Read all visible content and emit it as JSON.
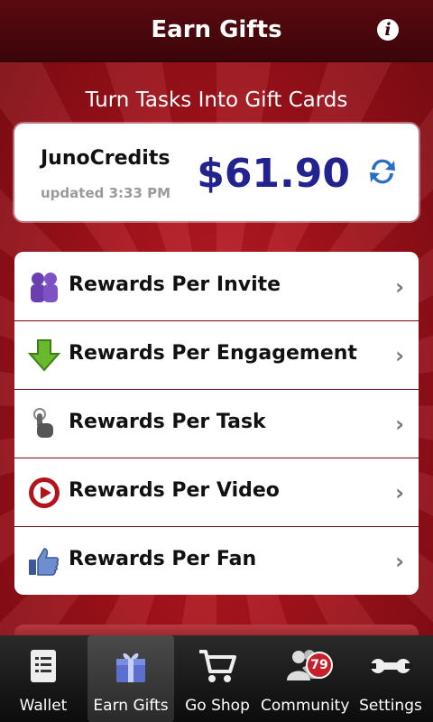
{
  "header": {
    "title": "Earn Gifts",
    "info_icon": "info-icon"
  },
  "subtitle": "Turn Tasks Into Gift Cards",
  "balance": {
    "label": "JunoCredits",
    "updated": "updated 3:33 PM",
    "amount": "$61.90",
    "refresh_icon": "refresh-icon"
  },
  "menu": [
    {
      "label": "Rewards Per Invite",
      "icon": "people-icon"
    },
    {
      "label": "Rewards Per Engagement",
      "icon": "download-arrow-icon"
    },
    {
      "label": "Rewards Per Task",
      "icon": "tap-finger-icon"
    },
    {
      "label": "Rewards Per Video",
      "icon": "play-icon"
    },
    {
      "label": "Rewards Per Fan",
      "icon": "thumbs-up-icon"
    }
  ],
  "tabs": [
    {
      "label": "Wallet",
      "icon": "wallet-list-icon",
      "active": false
    },
    {
      "label": "Earn Gifts",
      "icon": "gift-icon",
      "active": true
    },
    {
      "label": "Go Shop",
      "icon": "cart-icon",
      "active": false
    },
    {
      "label": "Community",
      "icon": "community-icon",
      "active": false,
      "badge": "79"
    },
    {
      "label": "Settings",
      "icon": "wrench-icon",
      "active": false
    }
  ],
  "colors": {
    "accent_amount": "#23238f",
    "background_red": "#a5121b",
    "header_dark": "#3a0509",
    "badge_red": "#c8202a"
  }
}
